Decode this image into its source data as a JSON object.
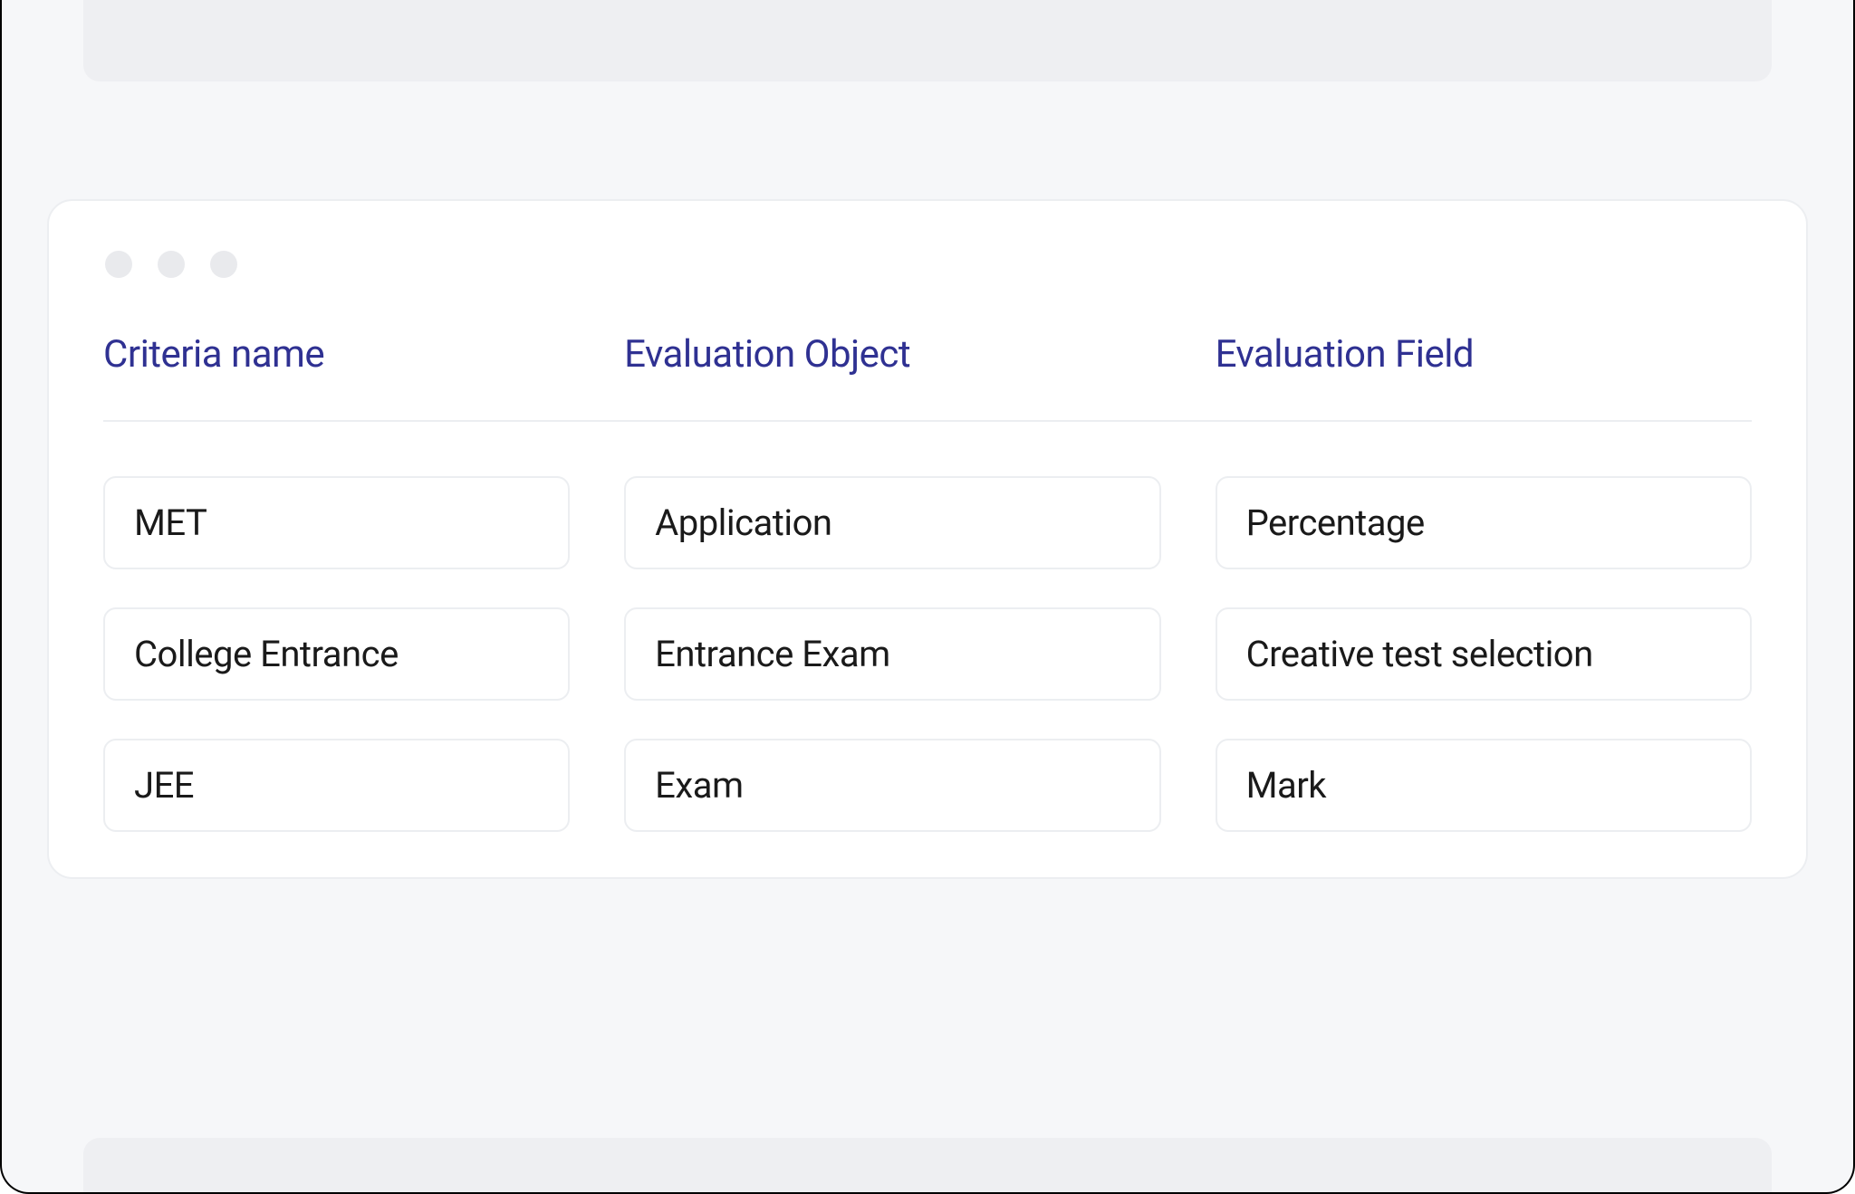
{
  "table": {
    "headers": {
      "criteria_name": "Criteria name",
      "evaluation_object": "Evaluation Object",
      "evaluation_field": "Evaluation Field"
    },
    "rows": [
      {
        "criteria_name": "MET",
        "evaluation_object": "Application",
        "evaluation_field": "Percentage"
      },
      {
        "criteria_name": "College Entrance",
        "evaluation_object": "Entrance Exam",
        "evaluation_field": "Creative test selection"
      },
      {
        "criteria_name": "JEE",
        "evaluation_object": "Exam",
        "evaluation_field": "Mark"
      }
    ]
  }
}
